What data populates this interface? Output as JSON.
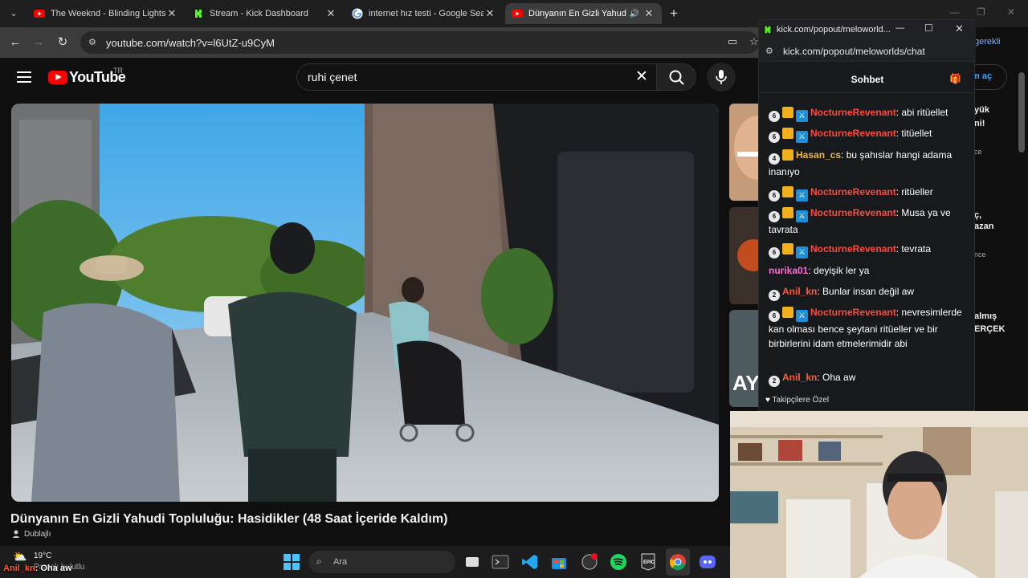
{
  "tabs": [
    {
      "title": "The Weeknd - Blinding Lights (",
      "icon": "youtube-icon"
    },
    {
      "title": "Stream - Kick Dashboard",
      "icon": "kick-icon"
    },
    {
      "title": "internet hız testi - Google Searc",
      "icon": "google-icon"
    },
    {
      "title": "Dünyanın En Gizli Yahudi To",
      "icon": "youtube-icon",
      "active": true
    }
  ],
  "address_bar": {
    "url": "youtube.com/watch?v=l6UtZ-u9CyM"
  },
  "youtube": {
    "logo_text": "YouTube",
    "country": "TR",
    "search_value": "ruhi çenet",
    "video_title": "Dünyanın En Gizli Yahudi Topluluğu: Hasidikler (48 Saat İçeride Kaldım)",
    "dubbed_label": "Dublajlı",
    "peek": [
      "yük",
      "ni!",
      "ç,",
      "azan",
      "almış",
      "ERÇEK",
      "m aç",
      " gerekli"
    ],
    "peek_dim": [
      "ce",
      "nce"
    ]
  },
  "popup": {
    "window_title": "kick.com/popout/meloworld...",
    "url": "kick.com/popout/meloworlds/chat",
    "chat_header": "Sohbet",
    "followers_only": "Takipçilere Özel",
    "colors": {
      "nocturne": "#ff4a3d",
      "hasan": "#f4b53f",
      "nurika": "#ff69d8",
      "anil": "#ff5c3a"
    },
    "messages": [
      {
        "level": "6",
        "crown": true,
        "mod": true,
        "user": "NocturneRevenant",
        "color": "#ff4a3d",
        "text": "abi ritüellet"
      },
      {
        "level": "6",
        "crown": true,
        "mod": true,
        "user": "NocturneRevenant",
        "color": "#ff4a3d",
        "text": "titüellet"
      },
      {
        "level": "4",
        "crown": true,
        "mod": false,
        "user": "Hasan_cs",
        "color": "#f4b53f",
        "text": "bu şahıslar hangi adama inanıyo"
      },
      {
        "level": "6",
        "crown": true,
        "mod": true,
        "user": "NocturneRevenant",
        "color": "#ff4a3d",
        "text": "ritüeller"
      },
      {
        "level": "6",
        "crown": true,
        "mod": true,
        "user": "NocturneRevenant",
        "color": "#ff4a3d",
        "text": "Musa ya ve tavrata"
      },
      {
        "level": "6",
        "crown": true,
        "mod": true,
        "user": "NocturneRevenant",
        "color": "#ff4a3d",
        "text": "tevrata"
      },
      {
        "level": "",
        "crown": false,
        "mod": false,
        "user": "nurika01",
        "color": "#ff69d8",
        "text": "deyişik ler ya"
      },
      {
        "level": "2",
        "crown": false,
        "mod": false,
        "user": "Anil_kn",
        "color": "#ff5c3a",
        "text": "Bunlar insan değil aw"
      },
      {
        "level": "6",
        "crown": true,
        "mod": true,
        "user": "NocturneRevenant",
        "color": "#ff4a3d",
        "text": "nevresimlerde kan olması bence şeytani ritüeller ve bir birbirlerini idam etmelerimidir abi"
      },
      {
        "level": "2",
        "crown": false,
        "mod": false,
        "user": "Anil_kn",
        "color": "#ff5c3a",
        "text": "Oha aw"
      }
    ]
  },
  "taskbar": {
    "weather_temp": "19°C",
    "weather_desc": "Parçalı bulutlu",
    "search_placeholder": "Ara"
  },
  "stream_overlay": {
    "user": "Anil_kn",
    "text": "Oha aw"
  }
}
